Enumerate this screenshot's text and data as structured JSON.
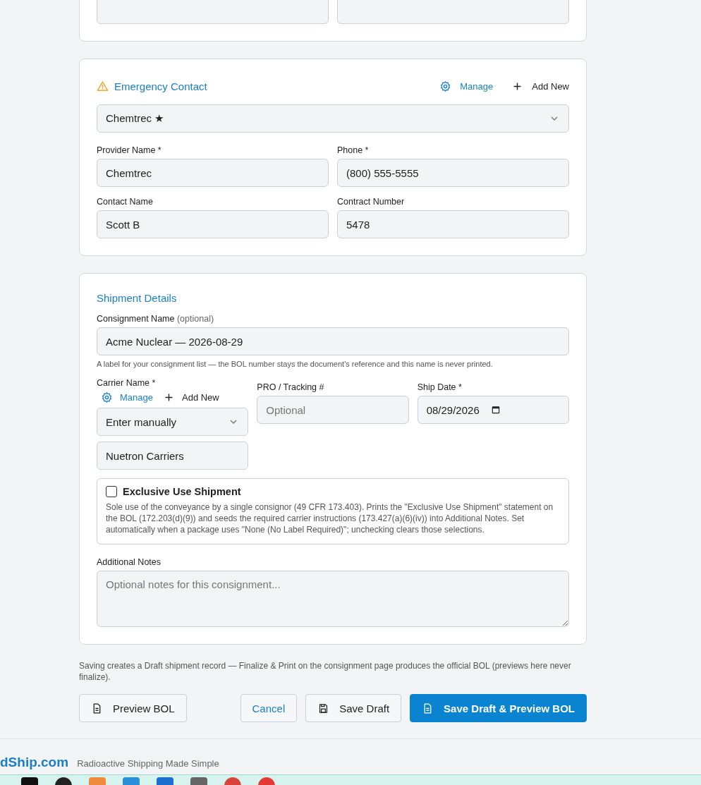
{
  "top_card": {
    "fields": [
      {
        "kind": "input"
      },
      {
        "kind": "input"
      }
    ]
  },
  "emergency_contact": {
    "title": "Emergency Contact",
    "manage": "Manage",
    "add_new": "Add New",
    "selected_provider": "Chemtrec ★",
    "fields": [
      {
        "label": "Provider Name *",
        "value": "Chemtrec"
      },
      {
        "label": "Phone *",
        "value": "(800) 555-5555"
      },
      {
        "label": "Contact Name",
        "value": "Scott B"
      },
      {
        "label": "Contract Number",
        "value": "5478"
      }
    ]
  },
  "shipment_details": {
    "title": "Shipment Details",
    "consignment_name": {
      "label": "Consignment Name",
      "label_note": "(optional)",
      "value": "Acme Nuclear — 2026-08-29",
      "help": "A label for your consignment list — the BOL number stays the document's reference and this name is never printed."
    },
    "carrier": {
      "label": "Carrier Name *",
      "manage": "Manage",
      "add_new": "Add New",
      "select": "Enter manually",
      "value": "Nuetron Carriers"
    },
    "tracking": {
      "label": "PRO / Tracking #",
      "placeholder": "Optional"
    },
    "ship_date": {
      "label": "Ship Date *",
      "value": "08/29/2026"
    },
    "exclusive_use": {
      "label": "Exclusive Use Shipment",
      "checked": false,
      "description": "Sole use of the conveyance by a single consignor (49 CFR 173.403). Prints the \"Exclusive Use Shipment\" statement on the BOL (172.203(d)(9)) and seeds the required carrier instructions (173.427(a)(6)(iv)) into Additional Notes. Set automatically when a package uses \"None (No Label Required)\"; unchecking clears those selections."
    },
    "notes": {
      "label": "Additional Notes",
      "placeholder": "Optional notes for this consignment..."
    }
  },
  "save_note": "Saving creates a Draft shipment record — Finalize & Print on the consignment page produces the official BOL (previews here never finalize).",
  "buttons": [
    {
      "kind": "preview",
      "label": "Preview BOL"
    },
    {
      "kind": "cancel",
      "label": "Cancel"
    },
    {
      "kind": "save",
      "label": "Save Draft"
    },
    {
      "kind": "primary",
      "label": "Save Draft & Preview BOL"
    }
  ],
  "footer": {
    "brand": "dShip.com",
    "tagline": "Radioactive Shipping Made Simple"
  }
}
